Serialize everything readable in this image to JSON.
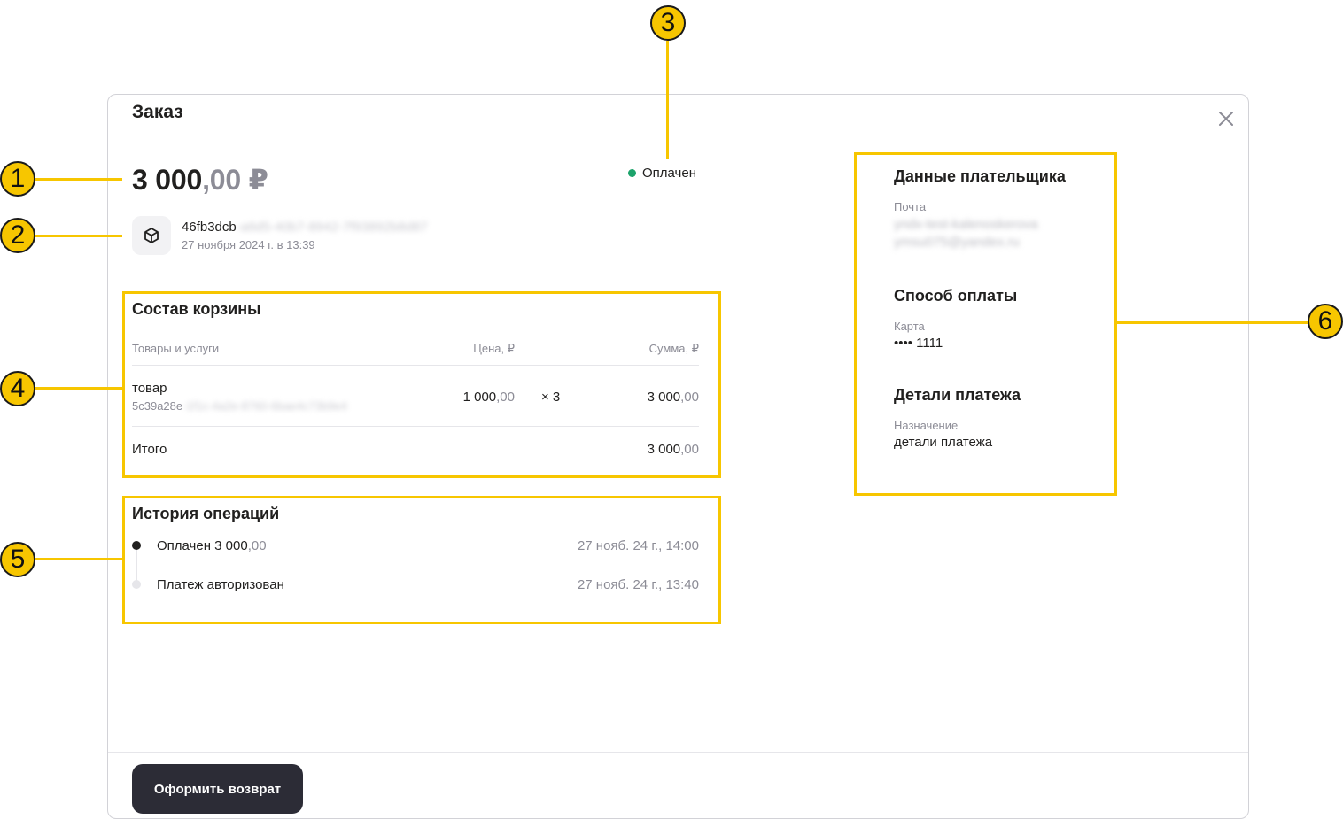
{
  "modal": {
    "title": "Заказ",
    "amount_whole": "3 000",
    "amount_fraction": ",00 ₽",
    "status": {
      "label": "Оплачен",
      "color": "#1ca36b"
    },
    "order": {
      "id_visible": "46fb3dcb",
      "id_hidden": "-a6d5-40b7-8942-7f93892b8d87",
      "date": "27 ноября 2024 г. в 13:39",
      "icon": "cube-icon"
    },
    "cart": {
      "title": "Состав корзины",
      "columns": [
        "Товары и услуги",
        "Цена, ₽",
        "",
        "Сумма, ₽"
      ],
      "items": [
        {
          "name": "товар",
          "id_visible": "5c39a28e",
          "id_hidden": "-1f1c-4a2e-8760-6bae4c73b9e4",
          "price_whole": "1 000",
          "price_fraction": ",00",
          "qty": "× 3",
          "sum_whole": "3 000",
          "sum_fraction": ",00"
        }
      ],
      "total_label": "Итого",
      "total_whole": "3 000",
      "total_fraction": ",00"
    },
    "history": {
      "title": "История операций",
      "events": [
        {
          "label": "Оплачен 3 000",
          "fraction": ",00",
          "date": "27 нояб. 24 г., 14:00",
          "dot_color": "#21201f"
        },
        {
          "label": "Платеж авторизован",
          "fraction": "",
          "date": "27 нояб. 24 г., 13:40",
          "dot_color": "#e6e6ea"
        }
      ]
    },
    "payer": {
      "title": "Данные плательщика",
      "email_label": "Почта",
      "email_line1": "yndx-test-kalenoskerova",
      "email_line2": "ymsu075@yandex.ru",
      "method_title": "Способ оплаты",
      "method_label": "Карта",
      "method_value": "•••• 1111",
      "details_title": "Детали платежа",
      "details_label": "Назначение",
      "details_value": "детали платежа"
    },
    "refund_button": "Оформить возврат"
  },
  "colors": {
    "accent_highlight": "#f7c600",
    "button_bg": "#2c2c36",
    "status_green": "#1ca36b"
  },
  "annotations": [
    "1",
    "2",
    "3",
    "4",
    "5",
    "6"
  ]
}
